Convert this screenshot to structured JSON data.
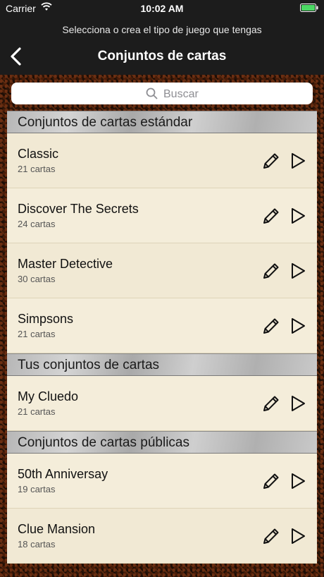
{
  "status_bar": {
    "carrier": "Carrier",
    "time": "10:02 AM",
    "wifi_icon": "wifi-icon",
    "battery_icon": "battery-icon",
    "battery_color": "#4cd964"
  },
  "nav": {
    "subtitle": "Selecciona o crea el tipo de juego que tengas",
    "title": "Conjuntos de cartas",
    "back_icon": "chevron-left-icon"
  },
  "search": {
    "placeholder": "Buscar",
    "icon": "search-icon"
  },
  "sections": [
    {
      "header": "Conjuntos de cartas estándar",
      "items": [
        {
          "name": "Classic",
          "count": "21 cartas"
        },
        {
          "name": "Discover The Secrets",
          "count": "24 cartas"
        },
        {
          "name": "Master Detective",
          "count": "30 cartas"
        },
        {
          "name": "Simpsons",
          "count": "21 cartas"
        }
      ]
    },
    {
      "header": "Tus conjuntos de cartas",
      "items": [
        {
          "name": "My Cluedo",
          "count": "21 cartas"
        }
      ]
    },
    {
      "header": "Conjuntos de cartas públicas",
      "items": [
        {
          "name": "50th Anniversay",
          "count": "19 cartas"
        },
        {
          "name": "Clue Mansion",
          "count": "18 cartas"
        }
      ]
    }
  ],
  "row_icons": {
    "edit": "pencil-icon",
    "play": "play-icon"
  }
}
